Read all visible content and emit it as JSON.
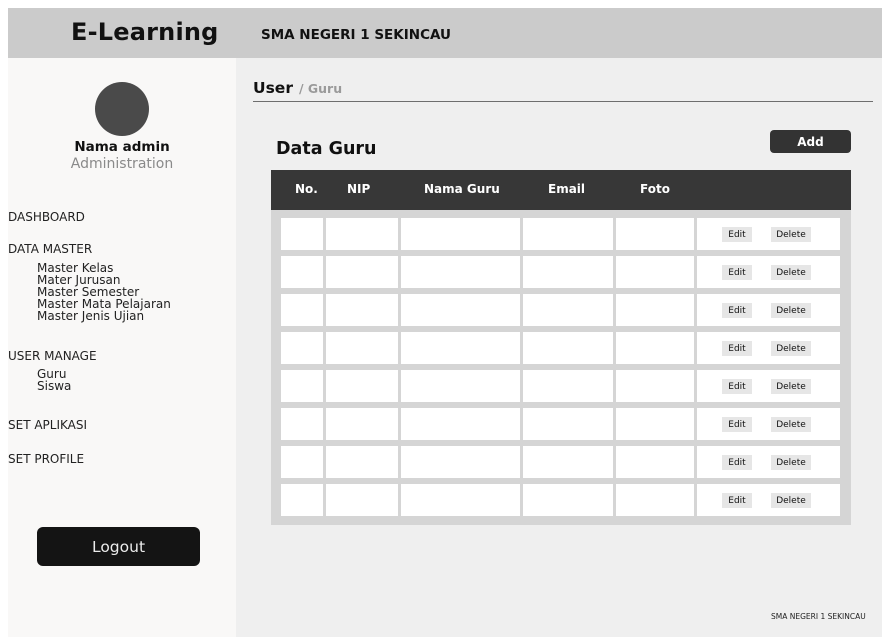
{
  "header": {
    "app_title": "E-Learning",
    "school_name": "SMA NEGERI 1 SEKINCAU"
  },
  "sidebar": {
    "admin_name": "Nama admin",
    "admin_role": "Administration",
    "dashboard": "DASHBOARD",
    "data_master": {
      "label": "DATA MASTER",
      "items": [
        "Master Kelas",
        "Mater Jurusan",
        "Master Semester",
        "Master Mata Pelajaran",
        "Master Jenis Ujian"
      ]
    },
    "user_manage": {
      "label": "USER MANAGE",
      "items": [
        "Guru",
        "Siswa"
      ]
    },
    "set_aplikasi": "SET APLIKASI",
    "set_profile": "SET PROFILE",
    "logout_label": "Logout"
  },
  "main": {
    "breadcrumb": {
      "current": "User",
      "sub": "/ Guru"
    },
    "section_title": "Data Guru",
    "add_label": "Add",
    "table": {
      "headers": [
        "No.",
        "NIP",
        "Nama Guru",
        "Email",
        "Foto"
      ],
      "edit_label": "Edit",
      "delete_label": "Delete",
      "row_count": 8
    }
  },
  "footer": {
    "text": "SMA NEGERI 1 SEKINCAU"
  },
  "colors": {
    "header_bg": "#cbcbcb",
    "table_header": "#373737",
    "logout_bg": "#141414",
    "avatar": "#4a4a4a"
  }
}
